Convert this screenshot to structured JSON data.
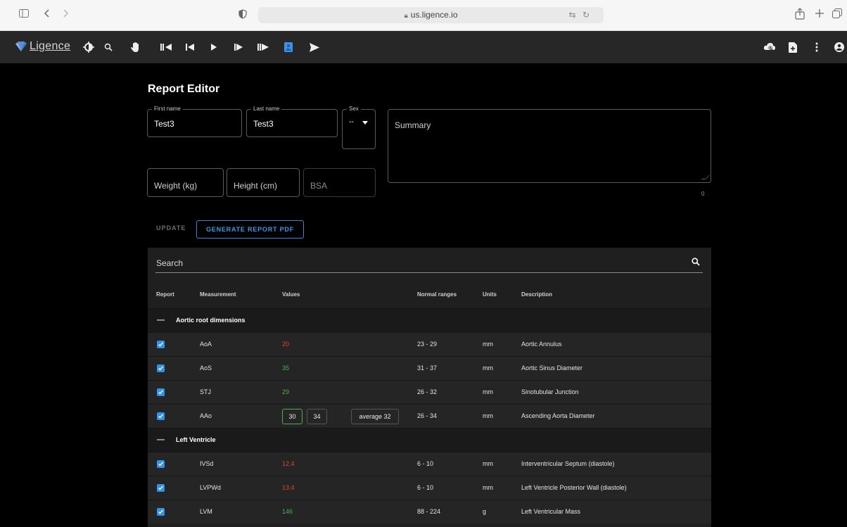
{
  "browser": {
    "url": "us.ligence.io"
  },
  "app": {
    "logo_text": "Ligence"
  },
  "page": {
    "title": "Report Editor"
  },
  "form": {
    "first_name_label": "First name",
    "first_name_value": "Test3",
    "last_name_label": "Last name",
    "last_name_value": "Test3",
    "sex_label": "Sex",
    "sex_value": "--",
    "weight_placeholder": "Weight (kg)",
    "height_placeholder": "Height (cm)",
    "bsa_placeholder": "BSA",
    "summary_placeholder": "Summary",
    "summary_counter": "0"
  },
  "actions": {
    "update_label": "UPDATE",
    "generate_label": "GENERATE REPORT PDF"
  },
  "table": {
    "search_label": "Search",
    "headers": {
      "report": "Report",
      "measurement": "Measurement",
      "values": "Values",
      "normal_ranges": "Normal ranges",
      "units": "Units",
      "description": "Description"
    },
    "groups": [
      {
        "dash": "—",
        "name": "Aortic root dimensions",
        "rows": [
          {
            "measurement": "AoA",
            "value": "20",
            "value_status": "out_of_range",
            "range": "23 - 29",
            "units": "mm",
            "description": "Aortic Annulus"
          },
          {
            "measurement": "AoS",
            "value": "35",
            "value_status": "in_range",
            "range": "31 - 37",
            "units": "mm",
            "description": "Aortic Sinus Diameter"
          },
          {
            "measurement": "STJ",
            "value": "29",
            "value_status": "in_range",
            "range": "26 - 32",
            "units": "mm",
            "description": "Sinotubular Junction"
          },
          {
            "measurement": "AAo",
            "value_boxes": [
              "30",
              "34"
            ],
            "average": "average 32",
            "range": "26 - 34",
            "units": "mm",
            "description": "Ascending Aorta Diameter"
          }
        ]
      },
      {
        "dash": "—",
        "name": "Left Ventricle",
        "rows": [
          {
            "measurement": "IVSd",
            "value": "12.4",
            "value_status": "out_of_range",
            "range": "6 - 10",
            "units": "mm",
            "description": "Interventricular Septum (diastole)"
          },
          {
            "measurement": "LVPWd",
            "value": "13.4",
            "value_status": "out_of_range",
            "range": "6 - 10",
            "units": "mm",
            "description": "Left Ventricle Posterior Wall (diastole)"
          },
          {
            "measurement": "LVM",
            "value": "146",
            "value_status": "in_range",
            "range": "88 - 224",
            "units": "g",
            "description": "Left Ventricular Mass"
          }
        ]
      }
    ]
  },
  "colors": {
    "accent": "#3291e8",
    "out_of_range": "#e0452f",
    "in_range": "#4caf50"
  }
}
